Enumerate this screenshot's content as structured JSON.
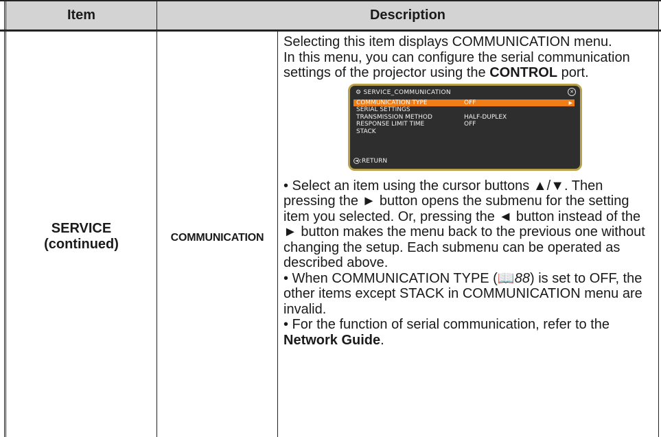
{
  "header": {
    "item": "Item",
    "description": "Description"
  },
  "row": {
    "item_line1": "SERVICE",
    "item_line2": "(continued)",
    "subitem": "COMMUNICATION",
    "para1": "Selecting this item displays COMMUNICATION menu.",
    "para2_before": "In this menu, you can configure the serial communication settings of the projector using the ",
    "para2_bold": "CONTROL",
    "para2_after": " port.",
    "para3": "• Select an item using the cursor buttons ▲/▼. Then pressing the ► button opens the submenu for the setting item you selected. Or, pressing the ◄ button instead of the ► button makes the menu back to the previous one without changing the setup. Each submenu can be operated as described above.",
    "para4_before": "• When COMMUNICATION TYPE (",
    "para4_book_icon": "book-icon",
    "para4_page": "88",
    "para4_after": ") is set to OFF, the other items except STACK in COMMUNICATION menu are invalid.",
    "para5_before": "• For the function of serial communication, refer to the ",
    "para5_bold": "Network Guide",
    "para5_after": "."
  },
  "menu": {
    "title": "SERVICE_COMMUNICATION",
    "rows": [
      {
        "label": "COMMUNICATION TYPE",
        "value": "OFF"
      },
      {
        "label": "SERIAL SETTINGS",
        "value": ""
      },
      {
        "label": "TRANSMISSION METHOD",
        "value": "HALF-DUPLEX"
      },
      {
        "label": "RESPONSE LIMIT TIME",
        "value": "OFF"
      },
      {
        "label": "STACK",
        "value": ""
      }
    ],
    "return_label": "RETURN",
    "colors": {
      "background": "#2e2e2e",
      "selected": "#f07d16",
      "frame": "#b8a24e"
    }
  }
}
